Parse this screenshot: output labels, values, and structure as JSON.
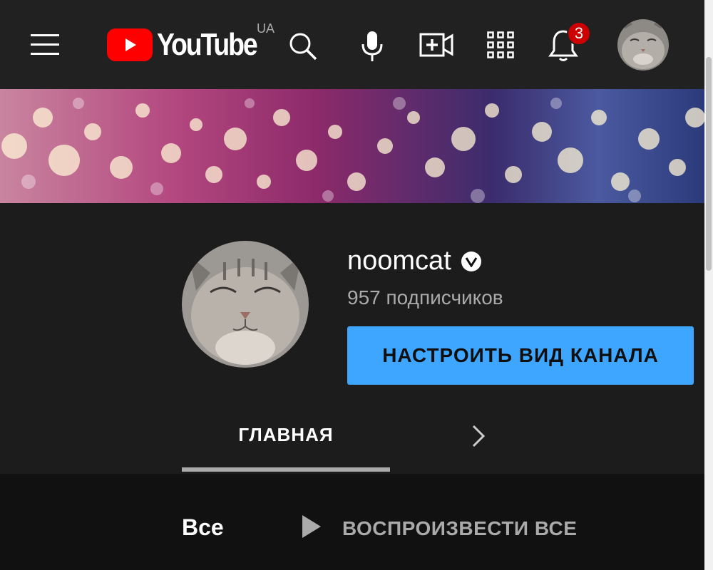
{
  "header": {
    "logo_text": "YouTube",
    "region": "UA",
    "notifications_count": "3"
  },
  "channel": {
    "name": "noomcat",
    "subscribers": "957 подписчиков",
    "customize_label": "НАСТРОИТЬ ВИД КАНАЛА"
  },
  "tabs": {
    "home": "ГЛАВНАЯ"
  },
  "filters": {
    "all": "Все",
    "play_all": "ВОСПРОИЗВЕСТИ ВСЕ"
  },
  "colors": {
    "accent": "#3ea6ff",
    "brand": "#ff0000",
    "badge": "#cc0000"
  },
  "icons": [
    "menu-icon",
    "search-icon",
    "mic-icon",
    "create-video-icon",
    "apps-icon",
    "bell-icon",
    "verified-icon",
    "chevron-right-icon",
    "play-icon"
  ]
}
